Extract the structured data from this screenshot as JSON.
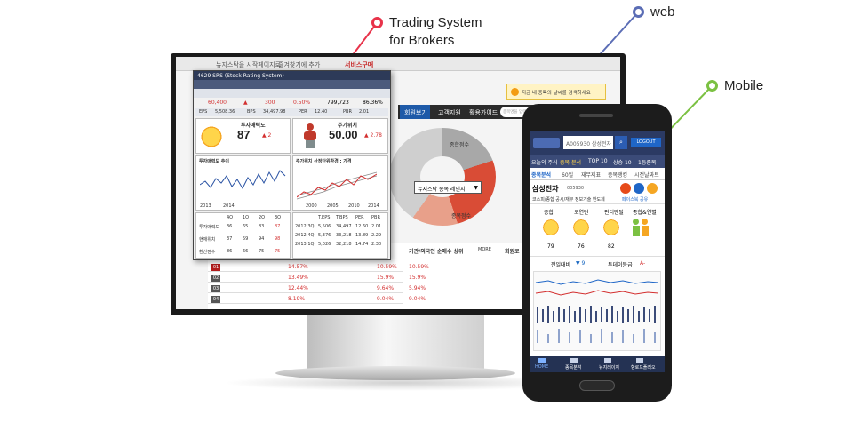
{
  "callouts": [
    {
      "label_line1": "Trading System",
      "label_line2": "for Brokers",
      "color": "#e8334a"
    },
    {
      "label_line1": "web",
      "label_line2": "",
      "color": "#5b6db5"
    },
    {
      "label_line1": "Mobile",
      "label_line2": "",
      "color": "#7bc142"
    }
  ],
  "web": {
    "tabs": [
      "뉴지스탁을 시작페이지로",
      "즐겨찾기에 추가",
      "서비스구매"
    ],
    "nav": [
      "회원보기",
      "고객지원",
      "활용가이드"
    ],
    "search_placeholder": "종목명을 입력하세요",
    "banner_text": "지금 내 종목의 날씨를 검색하세요",
    "donut_labels": [
      "종합점수",
      "종목점수"
    ],
    "dropdown_label": "뉴지스탁 종목 레인지",
    "ranking_title": "기관/외국인 순매수 상위",
    "ranking_more": "MORE",
    "member_title": "회원로",
    "rows": [
      {
        "no": "01",
        "pct": "14.57%",
        "pct2": "10.59%",
        "pct3": "10.59%"
      },
      {
        "no": "02",
        "pct": "13.49%",
        "pct2": "15.9%",
        "pct3": "15.9%"
      },
      {
        "no": "03",
        "pct": "12.44%",
        "pct2": "9.64%",
        "pct3": "5.94%"
      },
      {
        "no": "04",
        "pct": "8.19%",
        "pct2": "9.04%",
        "pct3": "9.04%"
      }
    ]
  },
  "trade": {
    "title": "4629 SRS (Stock Rating System)",
    "prices": [
      "60,400",
      "▲",
      "300",
      "0.50%",
      "799,723",
      "86.36%"
    ],
    "metrics": [
      "EPS",
      "5,508.36",
      "BPS",
      "34,497.98",
      "PER",
      "12.40",
      "PBR",
      "2.01"
    ],
    "left_panel_title": "투자매력도",
    "left_value": "87",
    "left_change": "▲ 2",
    "right_panel_title": "주가위치",
    "right_value": "50.00",
    "right_change": "▲ 2.78",
    "left_chart_title": "투자매력도 추이",
    "right_chart_title": "주가위치 산정단위환경 : 가격",
    "axis_years_left": [
      "2013",
      "2014"
    ],
    "axis_years_right": [
      "2000",
      "2005",
      "2010",
      "2014"
    ],
    "table_header": [
      "4Q",
      "1Q",
      "2Q",
      "3Q"
    ],
    "table_rows": [
      {
        "label": "투자매력도",
        "values": [
          "36",
          "65",
          "83",
          "87"
        ]
      },
      {
        "label": "현재위치",
        "values": [
          "37",
          "59",
          "94",
          "98"
        ]
      },
      {
        "label": "환산점수",
        "values": [
          "86",
          "66",
          "75",
          "75"
        ]
      }
    ],
    "eps_table": [
      "T.EPS",
      "T.BPS",
      "PER",
      "PBR"
    ],
    "eps_rows": [
      [
        "2012.3Q",
        "5,506",
        "34,497",
        "12.60",
        "2.01"
      ],
      [
        "2012.4Q",
        "5,376",
        "33,218",
        "13.89",
        "2.29"
      ],
      [
        "2013.1Q",
        "5,026",
        "32,218",
        "14.74",
        "2.30"
      ]
    ]
  },
  "mobile": {
    "search_value": "A005930 삼성전자",
    "logout_label": "LOGOUT",
    "nav": [
      "오늘의 주식",
      "종목 분석",
      "TOP 10",
      "상승 10",
      "1등종목"
    ],
    "subnav": [
      "종목분석",
      "60일",
      "재무제표",
      "종목랭킹",
      "시전날짜트"
    ],
    "stock_name": "삼성전자",
    "stock_code": "005930",
    "desc": "코스피/종합 공시/재무 정보기술 반도체",
    "share_label": "페이스북 공유",
    "weather": [
      {
        "label": "종합",
        "value": "79"
      },
      {
        "label": "오연탄",
        "value": "76"
      },
      {
        "label": "펀더멘탈",
        "value": "82"
      },
      {
        "label": "종합&연별",
        "value": ""
      }
    ],
    "compare_label": "전일대비",
    "compare_value": "▼ 9",
    "invest_label": "투데이등급",
    "invest_value": "A-",
    "footer": [
      "HOME",
      "종목분석",
      "뉴지레이지",
      "항로드플러오"
    ],
    "brand_colors": {
      "header": "#2b3a63",
      "accent": "#1f66c7"
    }
  }
}
